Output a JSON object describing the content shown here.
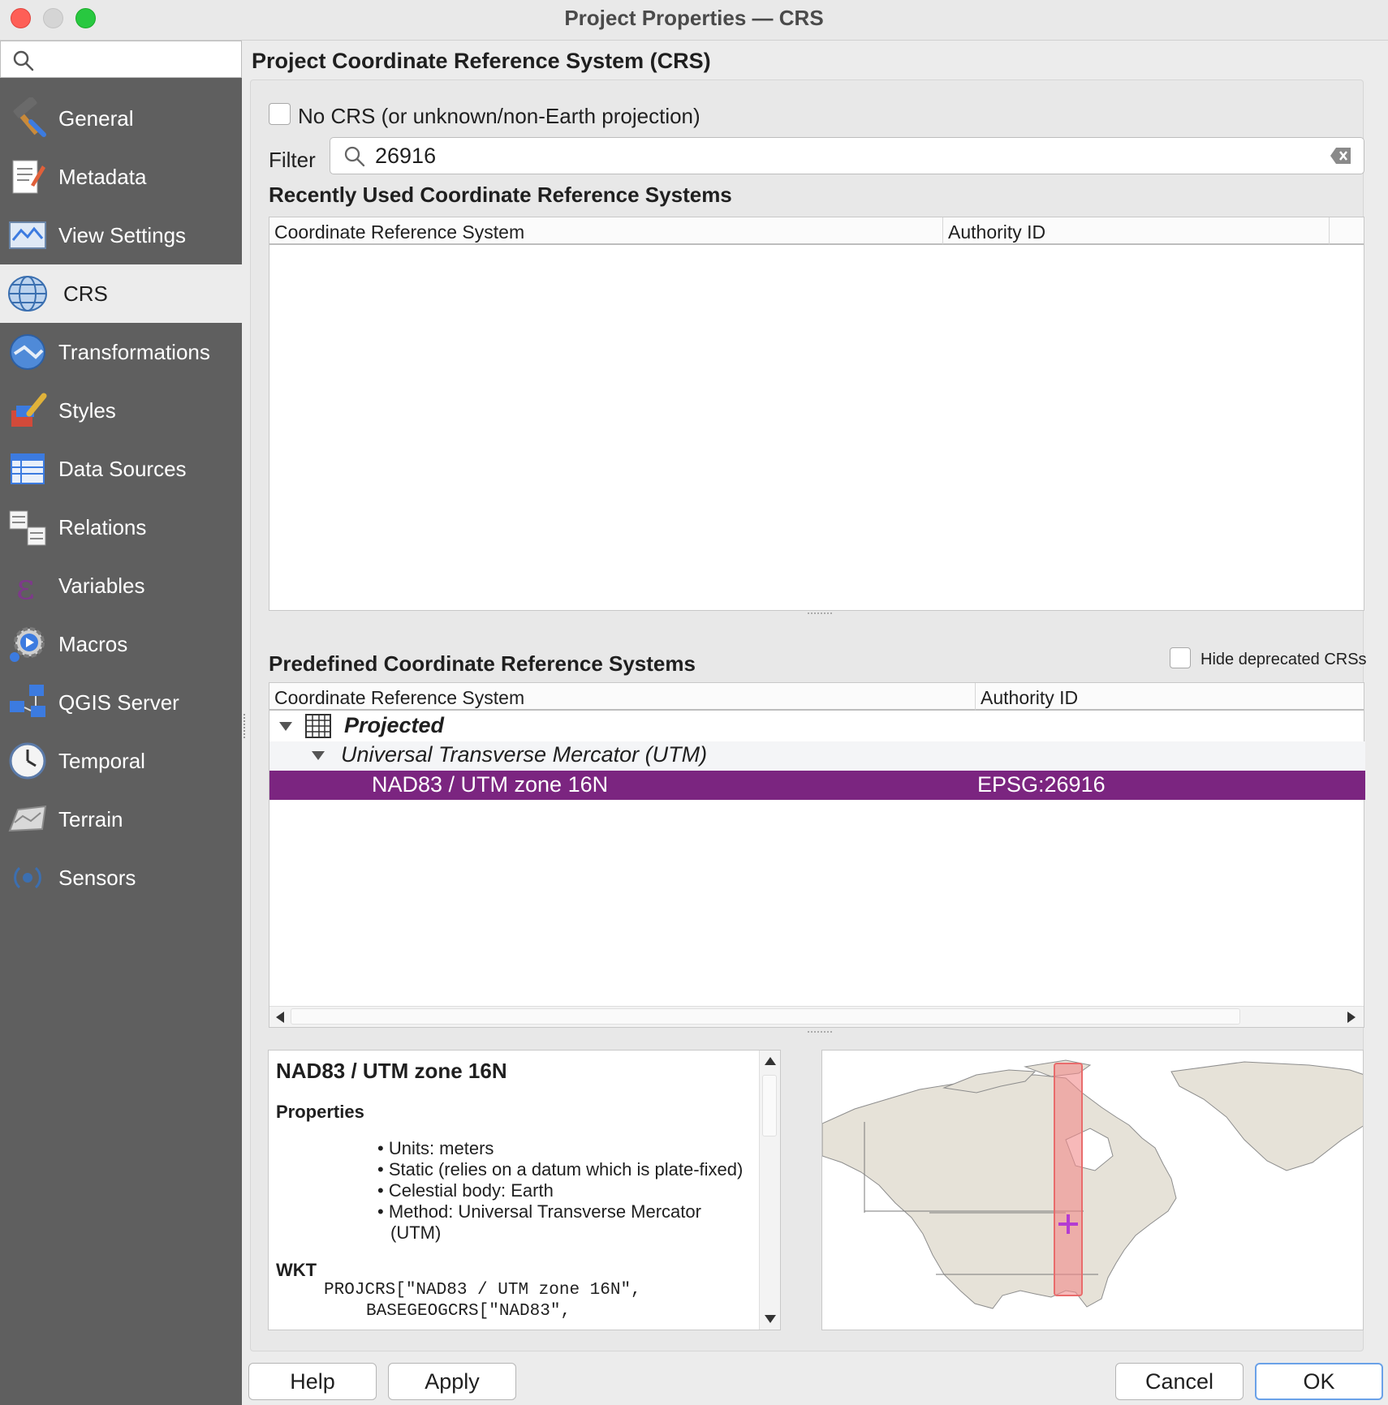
{
  "window": {
    "title": "Project Properties — CRS"
  },
  "sidebar": {
    "search_placeholder": "",
    "items": [
      {
        "label": "General",
        "icon": "hammer-icon"
      },
      {
        "label": "Metadata",
        "icon": "document-pen-icon"
      },
      {
        "label": "View Settings",
        "icon": "map-view-icon"
      },
      {
        "label": "CRS",
        "icon": "globe-grid-icon",
        "active": true
      },
      {
        "label": "Transformations",
        "icon": "globe-transform-icon"
      },
      {
        "label": "Styles",
        "icon": "paintbrush-icon"
      },
      {
        "label": "Data Sources",
        "icon": "table-icon"
      },
      {
        "label": "Relations",
        "icon": "relations-icon"
      },
      {
        "label": "Variables",
        "icon": "epsilon-icon"
      },
      {
        "label": "Macros",
        "icon": "gear-play-icon"
      },
      {
        "label": "QGIS Server",
        "icon": "server-icon"
      },
      {
        "label": "Temporal",
        "icon": "clock-icon"
      },
      {
        "label": "Terrain",
        "icon": "terrain-icon"
      },
      {
        "label": "Sensors",
        "icon": "sensor-icon"
      }
    ]
  },
  "main": {
    "heading": "Project Coordinate Reference System (CRS)",
    "no_crs_label": "No CRS (or unknown/non-Earth projection)",
    "filter": {
      "label": "Filter",
      "value": "26916"
    },
    "recent": {
      "heading": "Recently Used Coordinate Reference Systems",
      "columns": [
        "Coordinate Reference System",
        "Authority ID"
      ]
    },
    "predefined": {
      "heading": "Predefined Coordinate Reference Systems",
      "hide_deprecated_label": "Hide deprecated CRSs",
      "columns": [
        "Coordinate Reference System",
        "Authority ID"
      ],
      "tree": {
        "group": "Projected",
        "subgroup": "Universal Transverse Mercator (UTM)",
        "selected": {
          "name": "NAD83 / UTM zone 16N",
          "authority": "EPSG:26916"
        }
      }
    },
    "details": {
      "title": "NAD83 / UTM zone 16N",
      "properties_heading": "Properties",
      "properties": [
        "Units: meters",
        "Static (relies on a datum which is plate-fixed)",
        "Celestial body: Earth",
        "Method: Universal Transverse Mercator",
        "(UTM)"
      ],
      "wkt_heading": "WKT",
      "wkt_lines": [
        "PROJCRS[\"NAD83 / UTM zone 16N\",",
        "BASEGEOGCRS[\"NAD83\","
      ]
    },
    "colors": {
      "selection": "#7b2580",
      "zone_band": "#f28b8b",
      "marker": "#b43cd2",
      "land": "#e6e2d8"
    }
  },
  "buttons": {
    "help": "Help",
    "apply": "Apply",
    "cancel": "Cancel",
    "ok": "OK"
  }
}
